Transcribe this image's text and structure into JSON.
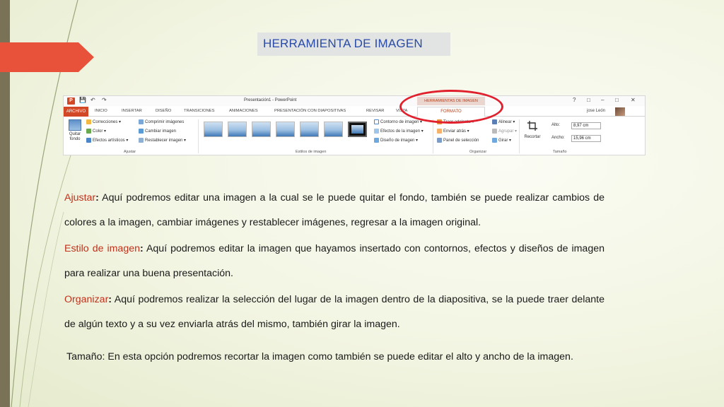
{
  "slide": {
    "title": "HERRAMIENTA DE IMAGEN"
  },
  "ribbon": {
    "app_logo": "P",
    "quick_access": {
      "save": "💾",
      "undo": "↶",
      "redo": "↷"
    },
    "doc_title": "Presentación1 - PowerPoint",
    "context_tab": "HERRAMIENTAS DE IMAGEN",
    "window_buttons": {
      "help": "?",
      "restore": "□",
      "minimize": "–",
      "maximize": "□",
      "close": "✕"
    },
    "tabs": [
      "ARCHIVO",
      "INICIO",
      "INSERTAR",
      "DISEÑO",
      "TRANSICIONES",
      "ANIMACIONES",
      "PRESENTACIÓN CON DIAPOSITIVAS",
      "REVISAR",
      "VISTA",
      "FORMATO"
    ],
    "user": "jose León",
    "ajustar": {
      "quitar_fondo": "Quitar fondo",
      "correcciones": "Correcciones ▾",
      "color": "Color ▾",
      "efectos_artisticos": "Efectos artísticos ▾",
      "comprimir": "Comprimir imágenes",
      "cambiar": "Cambiar imagen",
      "restablecer": "Restablecer imagen ▾",
      "label": "Ajustar"
    },
    "estilos": {
      "label": "Estilos de imagen",
      "contorno": "Contorno de imagen ▾",
      "efectos": "Efectos de la imagen ▾",
      "diseno": "Diseño de imagen ▾"
    },
    "organizar": {
      "label": "Organizar",
      "traer": "Traer adelante ▾",
      "enviar": "Enviar atrás ▾",
      "panel": "Panel de selección",
      "alinear": "Alinear ▾",
      "agrupar": "Agrupar ▾",
      "girar": "Girar ▾"
    },
    "tamano": {
      "label": "Tamaño",
      "recortar": "Recortar",
      "alto_label": "Alto:",
      "alto_value": "8,97 cm",
      "ancho_label": "Ancho:",
      "ancho_value": "15,96 cm"
    }
  },
  "content": {
    "ajustar_kw": "Ajustar",
    "ajustar_text": " Aquí podremos editar una imagen a la cual se le puede quitar el fondo, también se puede realizar cambios de colores a la imagen, cambiar imágenes y restablecer imágenes, regresar a la imagen original.",
    "estilo_kw": "Estilo de imagen",
    "estilo_text": " Aquí podremos editar la imagen que hayamos insertado con contornos, efectos y diseños de imagen para realizar una buena presentación.",
    "organizar_kw": "Organizar",
    "organizar_text": " Aquí podremos realizar la selección del lugar de la imagen dentro de la diapositiva, se la puede traer delante de algún texto y a su vez enviarla atrás del mismo, también girar la imagen.",
    "colon": ":",
    "tamano_text": "Tamaño: En esta opción podremos recortar la imagen como también se puede editar el alto y ancho de la imagen."
  },
  "colors": {
    "accent_orange": "#e8513a",
    "keyword_red": "#c0311b",
    "title_blue": "#2a4aa8",
    "highlight_circle": "#e0202c"
  }
}
